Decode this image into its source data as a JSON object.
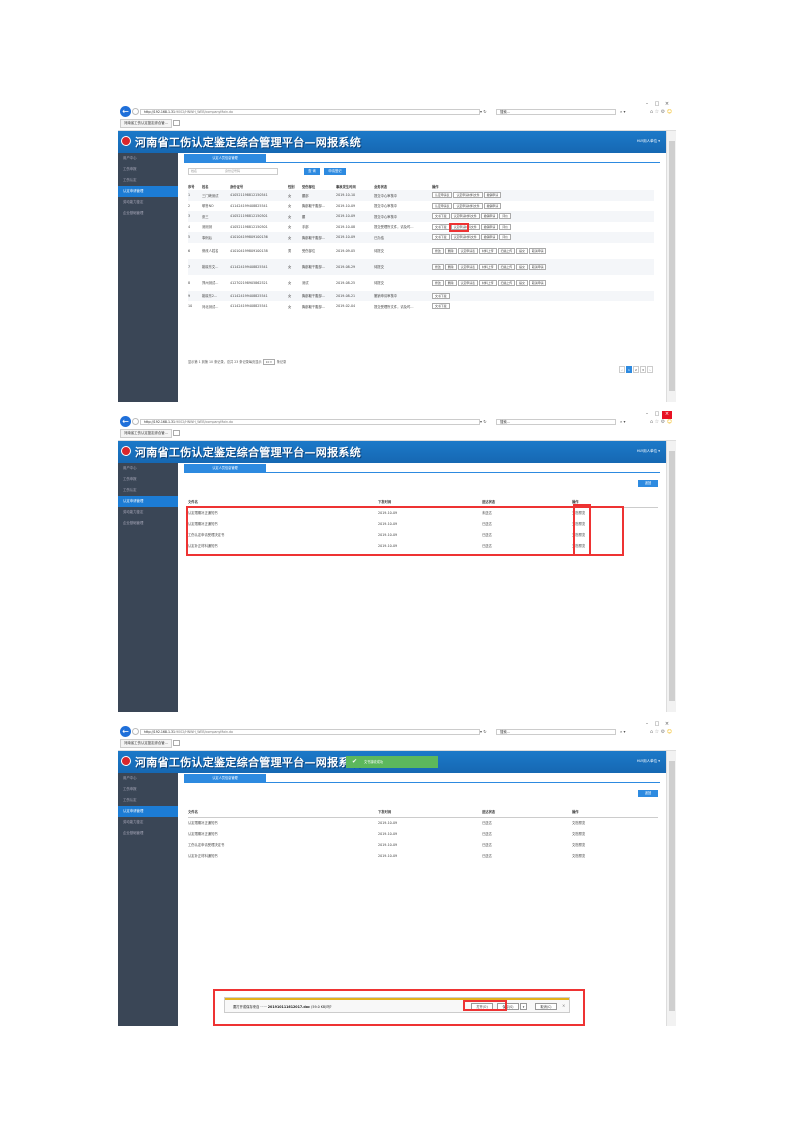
{
  "browser": {
    "address_host": "http://192.168.1.31",
    "address_rest": ":9002/HNWH_WEB/companyMain.do",
    "search_placeholder": "搜索...",
    "tab_title": "河南省工伤认定鉴定综合管…",
    "win_buttons": [
      "–",
      "□",
      "×"
    ]
  },
  "app": {
    "title": "河南省工伤认定鉴定综合管理平台—网报系统",
    "user_label": "HLY用人单位 ▾"
  },
  "sidebar": {
    "items": [
      "用户中心",
      "工伤申报",
      "工伤认定",
      "认定申请管理",
      "劳动能力鉴定",
      "企业基础管理"
    ]
  },
  "tab_label": "认定人员信息管理",
  "search": {
    "placeholder": "姓名",
    "placeholder2": "身份证号码",
    "query_label": "查 询",
    "register_label": "申请登记"
  },
  "table": {
    "headers": [
      "序号",
      "姓名",
      "身份证号",
      "性别",
      "受伤部位",
      "事故发生时间",
      "业务状态",
      "操作"
    ],
    "rows": [
      {
        "no": "1",
        "name": "三门峡测试",
        "id": "410521198812150541",
        "sex": "女",
        "part": "腰部",
        "date": "2019-10-10",
        "status": "提交中心审核中",
        "ops": [
          "认定申请表",
          "认定申请材料文件",
          "撤销申请"
        ]
      },
      {
        "no": "2",
        "name": "耶鲁NO",
        "id": "411424199408825541",
        "sex": "女",
        "part": "胸部躯干腹部…",
        "date": "2019-10-09",
        "status": "提交中心审核中",
        "ops": [
          "认定申请表",
          "认定申请材料文件",
          "撤销申请"
        ]
      },
      {
        "no": "3",
        "name": "张三",
        "id": "410521198812150501",
        "sex": "女",
        "part": "腰",
        "date": "2019-10-09",
        "status": "提交中心审核中",
        "ops": [
          "文书下载",
          "认定申请材料文件",
          "撤销申请",
          "评价"
        ]
      },
      {
        "no": "4",
        "name": "测测测",
        "id": "410521198812150501",
        "sex": "女",
        "part": "手部",
        "date": "2019-10-08",
        "status": "提交受理所文件，请及时…",
        "ops": [
          "文书下载",
          "认定申请材料文件",
          "撤销申请",
          "评价"
        ]
      },
      {
        "no": "5",
        "name": "事例后",
        "id": "410104199809100136",
        "sex": "女",
        "part": "胸部躯干腹部…",
        "date": "2019-10-09",
        "status": "已办结",
        "ops": [
          "文书下载",
          "认定申请材料文件",
          "撤销申请",
          "评价"
        ]
      },
      {
        "no": "6",
        "name": "修改人姓名",
        "id": "410104199809100138",
        "sex": "男",
        "part": "受伤部位",
        "date": "2019-09-05",
        "status": "待提交",
        "ops": [
          "修改",
          "删除",
          "认定申请表",
          "材料上传",
          "扫描上传",
          "提交",
          "取消申请"
        ]
      },
      {
        "no": "7",
        "name": "姚晓东文…",
        "id": "411424199408825541",
        "sex": "女",
        "part": "胸部躯干腹部…",
        "date": "2019-08-29",
        "status": "待提交",
        "ops": [
          "修改",
          "删除",
          "认定申请表",
          "材料上传",
          "扫描上传",
          "提交",
          "取消申请"
        ]
      },
      {
        "no": "8",
        "name": "郑州测试…",
        "id": "412702198905862521",
        "sex": "女",
        "part": "测试",
        "date": "2019-08-25",
        "status": "待提交",
        "ops": [
          "修改",
          "删除",
          "认定申请表",
          "材料上传",
          "扫描上传",
          "提交",
          "取消申请"
        ]
      },
      {
        "no": "9",
        "name": "姚晓东2…",
        "id": "411424199408825541",
        "sex": "女",
        "part": "胸部躯干腹部…",
        "date": "2019-08-21",
        "status": "撤销申请审核中",
        "ops": [
          "文书下载"
        ]
      },
      {
        "no": "10",
        "name": "河北测试…",
        "id": "411424199408825541",
        "sex": "女",
        "part": "胸部躯干腹部…",
        "date": "2019-02-04",
        "status": "提交受理所文件，请及时…",
        "ops": [
          "文书下载"
        ]
      }
    ],
    "page_info": "显示第 1 到第 10 条记录，总共 23 条记录每页显示",
    "page_size": "10 ▾",
    "page_info_suffix": "条记录",
    "pages": [
      "‹",
      "1",
      "2",
      "3",
      "›"
    ]
  },
  "docs": {
    "return_label": "返回",
    "headers": [
      "文件名",
      "下发时间",
      "送达状态",
      "操作"
    ],
    "rows_s2": [
      {
        "name": "认定限期补正通知书",
        "time": "2019-10-09",
        "state": "未送达",
        "op": "文档预览"
      },
      {
        "name": "认定限期补正通知书",
        "time": "2019-10-09",
        "state": "已送达",
        "op": "文档预览"
      },
      {
        "name": "工伤认定申请受理决定书",
        "time": "2019-10-09",
        "state": "已送达",
        "op": "文档预览"
      },
      {
        "name": "认定补正材料通知书",
        "time": "2019-10-09",
        "state": "已送达",
        "op": "文档预览"
      }
    ],
    "rows_s3": [
      {
        "name": "认定限期补正通知书",
        "time": "2019-10-09",
        "state": "已送达",
        "op": "文档预览"
      },
      {
        "name": "认定限期补正通知书",
        "time": "2019-10-09",
        "state": "已送达",
        "op": "文档预览"
      },
      {
        "name": "工伤认定申请受理决定书",
        "time": "2019-10-09",
        "state": "已送达",
        "op": "文档预览"
      },
      {
        "name": "认定补正材料通知书",
        "time": "2019-10-09",
        "state": "已送达",
        "op": "文档预览"
      }
    ]
  },
  "toast": {
    "text": "文书接收成功"
  },
  "download": {
    "prefix": "要打开或保存来自",
    "filename": "201910111612017.doc",
    "size": "(59.0 KB)吗?",
    "open_label": "打开(O)",
    "save_label": "保存(S)",
    "arrow_label": "▾",
    "cancel_label": "取消(C)",
    "close_label": "×"
  }
}
